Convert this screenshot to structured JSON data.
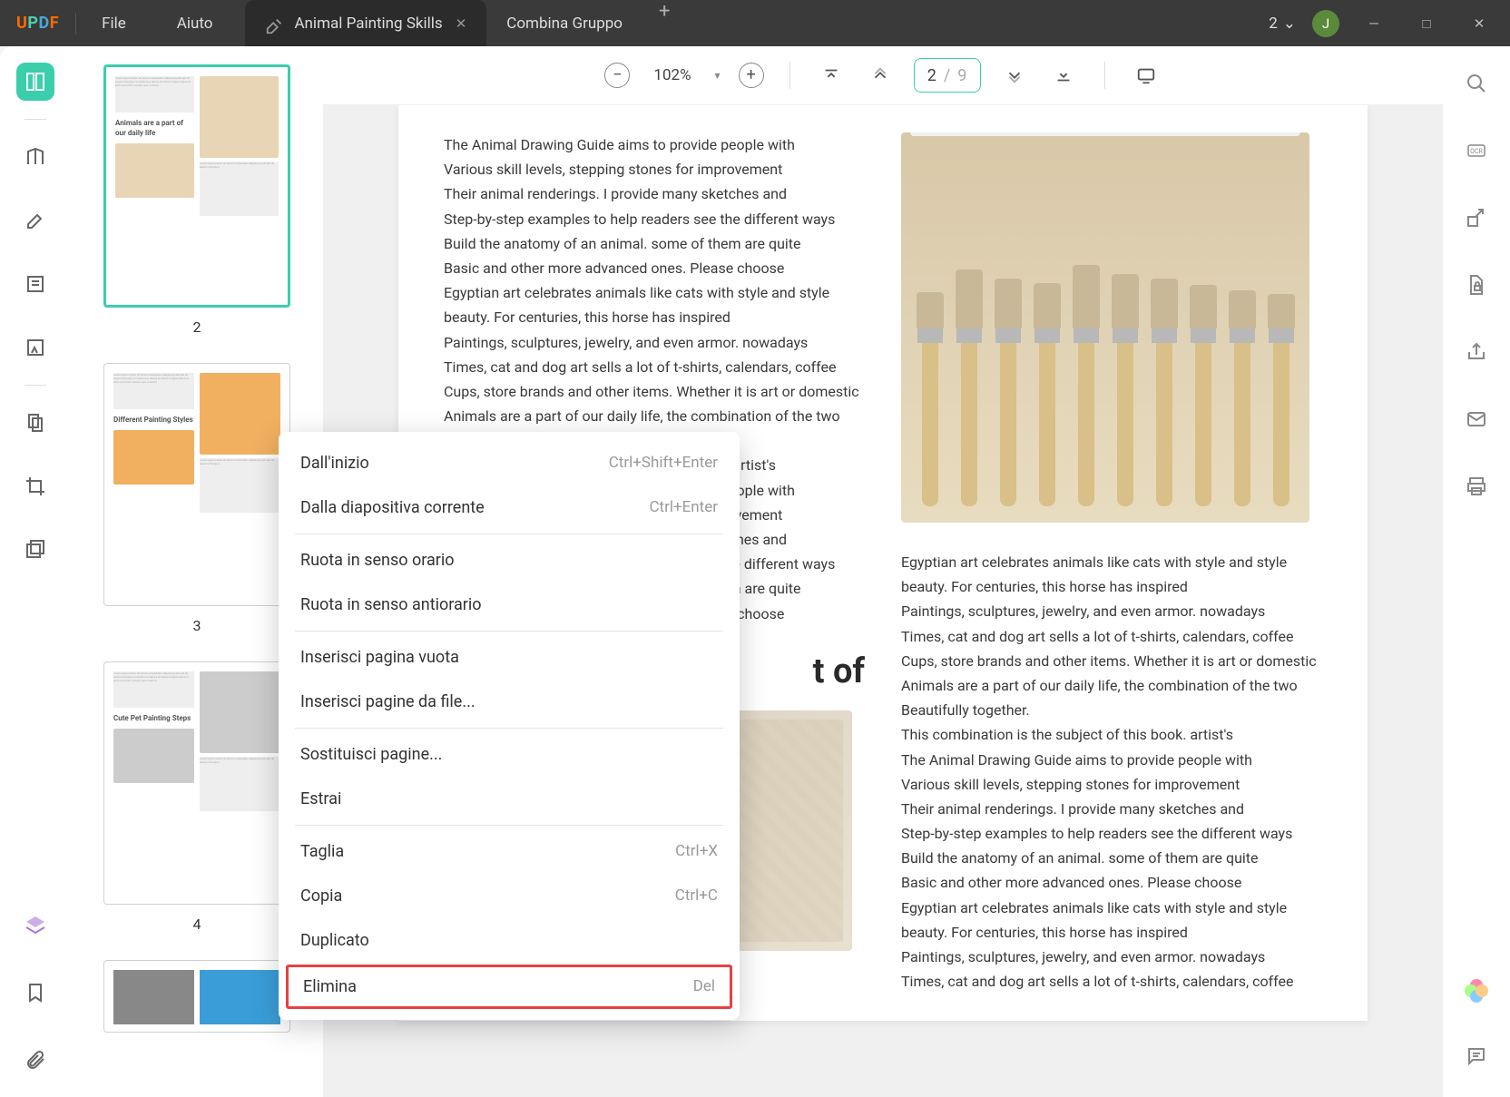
{
  "titlebar": {
    "menus": {
      "file": "File",
      "help": "Aiuto"
    },
    "tabs": [
      {
        "label": "Animal Painting Skills",
        "active": true
      },
      {
        "label": "Combina Gruppo",
        "active": false
      }
    ],
    "count": "2",
    "avatar_initial": "J"
  },
  "toolbar": {
    "zoom": "102%",
    "page_current": "2",
    "page_sep": "/",
    "page_total": "9"
  },
  "thumbnails": [
    {
      "num": "2",
      "selected": true,
      "heading": "Animals are a part of our daily life"
    },
    {
      "num": "3",
      "selected": false,
      "heading": "Different Painting Styles"
    },
    {
      "num": "4",
      "selected": false,
      "heading": "Cute Pet Painting Steps"
    }
  ],
  "document": {
    "col1_lines": [
      "The Animal Drawing Guide aims to provide people with",
      "Various skill levels, stepping stones for improvement",
      "Their animal renderings. I provide many sketches and",
      "Step-by-step examples to help readers see the different ways",
      "Build the anatomy of an animal. some of them are quite",
      "Basic and other more advanced ones. Please choose",
      "Egyptian art celebrates animals like cats with style and style",
      "beauty. For centuries, this horse has inspired",
      "Paintings, sculptures, jewelry, and even armor. nowadays",
      "Times, cat and dog art sells a lot of t-shirts, calendars, coffee",
      "Cups, store brands and other items. Whether it is art or domestic",
      "Animals are a part of our daily life, the combination of the two",
      "",
      "This combination is the subject of this book. artist's",
      "The Animal Drawing Guide aims to provide people with",
      "Various skill levels, stepping stones for improvement",
      "Their animal renderings. I provide many sketches and",
      "Step-by-step examples to help readers see the different ways",
      "Build the anatomy of an animal. some of them are quite",
      "Basic and other more advanced ones. Please choose"
    ],
    "heading_partial": "t of",
    "col2_lines": [
      "Egyptian art celebrates animals like cats with style and style",
      "beauty. For centuries, this horse has inspired",
      "Paintings, sculptures, jewelry, and even armor. nowadays",
      "Times, cat and dog art sells a lot of t-shirts, calendars, coffee",
      "Cups, store brands and other items. Whether it is art or domestic",
      "Animals are a part of our daily life, the combination of the two",
      "Beautifully together.",
      "This combination is the subject of this book. artist's",
      "The Animal Drawing Guide aims to provide people with",
      "Various skill levels, stepping stones for improvement",
      "Their animal renderings. I provide many sketches and",
      "Step-by-step examples to help readers see the different ways",
      "Build the anatomy of an animal. some of them are quite",
      "Basic and other more advanced ones. Please choose",
      "Egyptian art celebrates animals like cats with style and style",
      "beauty. For centuries, this horse has inspired",
      "Paintings, sculptures, jewelry, and even armor. nowadays",
      "Times, cat and dog art sells a lot of t-shirts, calendars, coffee"
    ]
  },
  "context_menu": {
    "items": [
      {
        "label": "Dall'inizio",
        "shortcut": "Ctrl+Shift+Enter",
        "type": "item"
      },
      {
        "label": "Dalla diapositiva corrente",
        "shortcut": "Ctrl+Enter",
        "type": "item"
      },
      {
        "type": "divider"
      },
      {
        "label": "Ruota in senso orario",
        "shortcut": "",
        "type": "item"
      },
      {
        "label": "Ruota in senso antiorario",
        "shortcut": "",
        "type": "item"
      },
      {
        "type": "divider"
      },
      {
        "label": "Inserisci pagina vuota",
        "shortcut": "",
        "type": "item"
      },
      {
        "label": "Inserisci pagine da file...",
        "shortcut": "",
        "type": "item"
      },
      {
        "type": "divider"
      },
      {
        "label": "Sostituisci pagine...",
        "shortcut": "",
        "type": "item"
      },
      {
        "label": "Estrai",
        "shortcut": "",
        "type": "item"
      },
      {
        "type": "divider"
      },
      {
        "label": "Taglia",
        "shortcut": "Ctrl+X",
        "type": "item"
      },
      {
        "label": "Copia",
        "shortcut": "Ctrl+C",
        "type": "item"
      },
      {
        "label": "Duplicato",
        "shortcut": "",
        "type": "item"
      },
      {
        "label": "Elimina",
        "shortcut": "Del",
        "type": "highlight"
      }
    ]
  },
  "palette_colors": [
    "#d88",
    "#e99",
    "#eba",
    "#ed8",
    "#dd7",
    "#9c8",
    "#6bb",
    "#7bd",
    "#88d",
    "#a8d",
    "#c8d",
    "#d8b"
  ]
}
